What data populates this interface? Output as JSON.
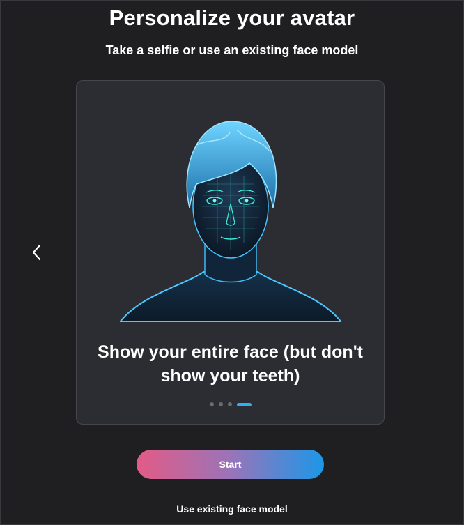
{
  "header": {
    "title": "Personalize your avatar",
    "subtitle": "Take a selfie or use an existing face model"
  },
  "carousel": {
    "caption": "Show your entire face (but don't show your teeth)",
    "illustration_icon": "face-mesh-illustration",
    "prev_icon": "chevron-left-icon",
    "slide_count": 4,
    "active_slide": 4,
    "accent_color": "#2ab3f2"
  },
  "actions": {
    "start_label": "Start",
    "existing_label": "Use existing face model",
    "start_gradient": [
      "#e35b86",
      "#1c97e8"
    ]
  }
}
